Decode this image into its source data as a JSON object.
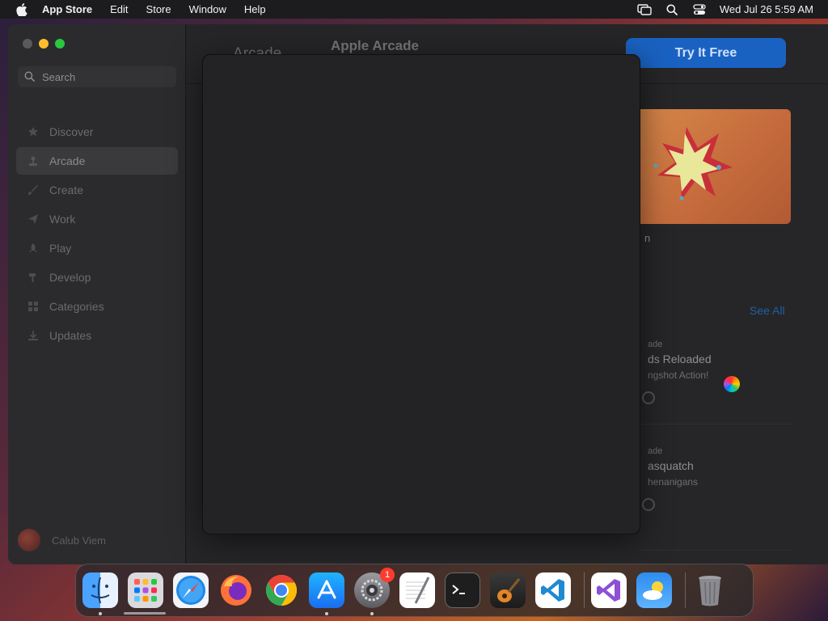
{
  "menubar": {
    "app_name": "App Store",
    "menus": [
      "Edit",
      "Store",
      "Window",
      "Help"
    ],
    "clock": "Wed Jul 26  5:59 AM"
  },
  "sidebar": {
    "search_placeholder": "Search",
    "items": [
      {
        "label": "Discover",
        "icon": "star-icon"
      },
      {
        "label": "Arcade",
        "icon": "joystick-icon",
        "active": true
      },
      {
        "label": "Create",
        "icon": "brush-icon"
      },
      {
        "label": "Work",
        "icon": "paperplane-icon"
      },
      {
        "label": "Play",
        "icon": "rocket-icon"
      },
      {
        "label": "Develop",
        "icon": "hammer-icon"
      },
      {
        "label": "Categories",
        "icon": "grid-icon"
      },
      {
        "label": "Updates",
        "icon": "download-icon"
      }
    ],
    "account_name": "Calub Viem"
  },
  "main": {
    "logo_text": "Arcade",
    "title": "Apple Arcade",
    "try_button": "Try It Free",
    "see_all": "See All",
    "fragments": {
      "feature_tail": "n",
      "row1_label": "ade",
      "row1_title": "ds Reloaded",
      "row1_sub": "ngshot Action!",
      "row2_label": "ade",
      "row2_title": "asquatch",
      "row2_sub": "henanigans"
    }
  },
  "dock": {
    "apps": [
      {
        "name": "Finder",
        "icon": "finder-icon",
        "running": true
      },
      {
        "name": "Launchpad",
        "icon": "launchpad-icon"
      },
      {
        "name": "Safari",
        "icon": "safari-icon"
      },
      {
        "name": "Firefox",
        "icon": "firefox-icon"
      },
      {
        "name": "Chrome",
        "icon": "chrome-icon"
      },
      {
        "name": "App Store",
        "icon": "appstore-icon",
        "running": true
      },
      {
        "name": "System Settings",
        "icon": "settings-icon",
        "running": true,
        "badge": "1"
      },
      {
        "name": "TextEdit",
        "icon": "textedit-icon"
      },
      {
        "name": "Terminal",
        "icon": "terminal-icon"
      },
      {
        "name": "GarageBand",
        "icon": "garageband-icon"
      },
      {
        "name": "Visual Studio Code",
        "icon": "vscode-icon"
      },
      {
        "name": "Visual Studio",
        "icon": "visualstudio-icon"
      },
      {
        "name": "Weather",
        "icon": "weather-icon"
      },
      {
        "name": "Trash",
        "icon": "trash-icon"
      }
    ]
  },
  "colors": {
    "accent": "#1a62c2",
    "menubar_bg": "#1c1c1e",
    "window_bg": "#262628"
  }
}
